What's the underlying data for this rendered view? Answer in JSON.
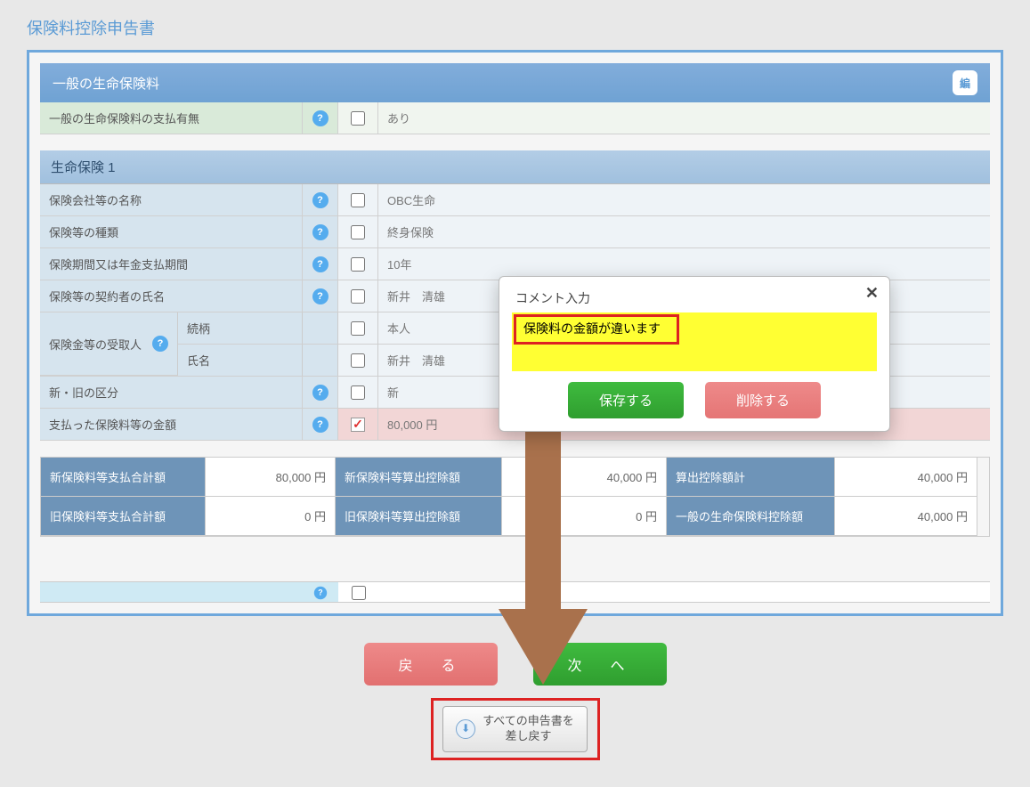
{
  "page_title": "保険料控除申告書",
  "section1": {
    "header": "一般の生命保険料",
    "edit_icon_label": "編",
    "row": {
      "label": "一般の生命保険料の支払有無",
      "value": "あり"
    }
  },
  "life1": {
    "header": "生命保険 1",
    "rows": {
      "company": {
        "label": "保険会社等の名称",
        "value": "OBC生命"
      },
      "type": {
        "label": "保険等の種類",
        "value": "終身保険"
      },
      "period": {
        "label": "保険期間又は年金支払期間",
        "value": "10年"
      },
      "contract": {
        "label": "保険等の契約者の氏名",
        "value": "新井　清雄"
      },
      "payee": {
        "main_label": "保険金等の受取人",
        "rel_label": "続柄",
        "rel_value": "本人",
        "name_label": "氏名",
        "name_value": "新井　清雄"
      },
      "division": {
        "label": "新・旧の区分",
        "value": "新"
      },
      "amount": {
        "label": "支払った保険料等の金額",
        "value": "80,000 円"
      }
    }
  },
  "summary": {
    "r1c1": "新保険料等支払合計額",
    "r1c2": "80,000 円",
    "r1c3": "新保険料等算出控除額",
    "r1c4": "40,000 円",
    "r1c5": "算出控除額計",
    "r1c6": "40,000 円",
    "r2c1": "旧保険料等支払合計額",
    "r2c2": "0 円",
    "r2c3": "旧保険料等算出控除額",
    "r2c4": "0 円",
    "r2c5": "一般の生命保険料控除額",
    "r2c6": "40,000 円"
  },
  "popup": {
    "title": "コメント入力",
    "text": "保険料の金額が違います",
    "save": "保存する",
    "delete": "削除する"
  },
  "nav": {
    "back": "戻　る",
    "next": "次　へ"
  },
  "return": {
    "label": "すべての申告書を\n差し戻す"
  },
  "colors": {
    "accent": "#6fa8dc",
    "green": "#2f9e2f",
    "pink": "#e57575",
    "highlight_red": "#d22"
  }
}
